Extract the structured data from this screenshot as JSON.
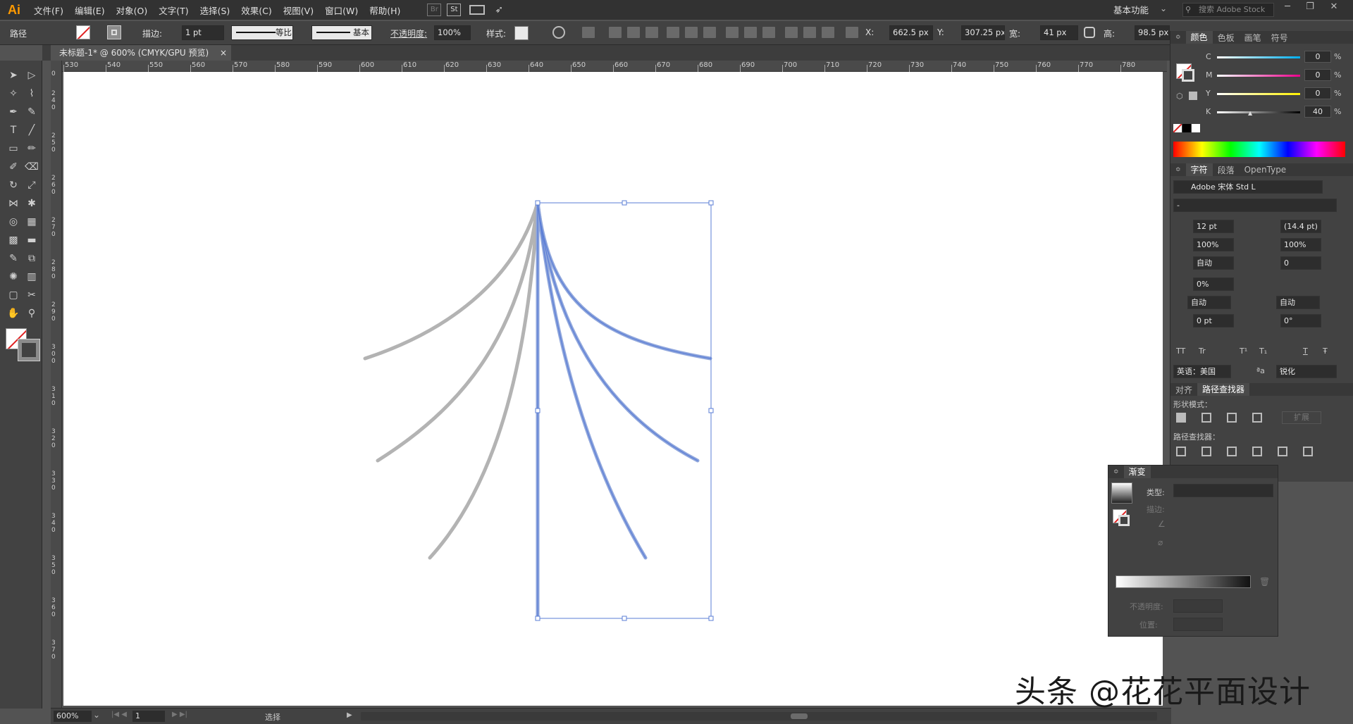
{
  "app": {
    "logo": "Ai"
  },
  "menu": [
    "文件(F)",
    "编辑(E)",
    "对象(O)",
    "文字(T)",
    "选择(S)",
    "效果(C)",
    "视图(V)",
    "窗口(W)",
    "帮助(H)"
  ],
  "menubar_right": {
    "workspace": "基本功能",
    "search_placeholder": "搜索 Adobe Stock",
    "bridge": "Br",
    "stock": "St"
  },
  "control": {
    "object_type": "路径",
    "stroke_label": "描边:",
    "stroke_weight": "1 pt",
    "profile": "等比",
    "brush": "基本",
    "opacity_label": "不透明度:",
    "opacity_value": "100%",
    "style_label": "样式:",
    "x_label": "X:",
    "x_value": "662.5 px",
    "y_label": "Y:",
    "y_value": "307.25 px",
    "w_label": "宽:",
    "w_value": "41 px",
    "h_label": "高:",
    "h_value": "98.5 px"
  },
  "document": {
    "tab_title": "未标题-1* @ 600% (CMYK/GPU 预览)",
    "close": "×"
  },
  "ruler_top": [
    "530",
    "540",
    "550",
    "560",
    "570",
    "580",
    "590",
    "600",
    "610",
    "620",
    "630",
    "640",
    "650",
    "660",
    "670",
    "680",
    "690",
    "700",
    "710",
    "720",
    "730",
    "740",
    "750",
    "760",
    "770",
    "780"
  ],
  "ruler_left": [
    "0",
    "240",
    "250",
    "260",
    "270",
    "280",
    "290",
    "300",
    "310",
    "320",
    "330",
    "340",
    "350",
    "360",
    "370"
  ],
  "status": {
    "zoom": "600%",
    "page": "1",
    "tool": "选择"
  },
  "color_panel": {
    "tabs": [
      "颜色",
      "色板",
      "画笔",
      "符号"
    ],
    "channels": [
      {
        "label": "C",
        "value": "0"
      },
      {
        "label": "M",
        "value": "0"
      },
      {
        "label": "Y",
        "value": "0"
      },
      {
        "label": "K",
        "value": "40"
      }
    ],
    "percent": "%"
  },
  "char_panel": {
    "tabs": [
      "字符",
      "段落",
      "OpenType"
    ],
    "font": "Adobe 宋体 Std L",
    "style": "-",
    "size": "12 pt",
    "leading": "(14.4 pt)",
    "vscale": "100%",
    "hscale": "100%",
    "kerning": "自动",
    "tracking": "0",
    "tsume": "0%",
    "aki_left": "自动",
    "aki_right": "自动",
    "baseline": "0 pt",
    "rotation": "0°",
    "tt": [
      "TT",
      "Tr",
      "T¹",
      "T₁",
      "T",
      "Ŧ"
    ],
    "language": "英语：美国",
    "aa_label": "ªa",
    "antialias": "锐化"
  },
  "pathfinder": {
    "tabs": [
      "对齐",
      "路径查找器"
    ],
    "shape_modes": "形状模式：",
    "expand": "扩展",
    "pathfinders": "路径查找器："
  },
  "gradient": {
    "title": "渐变",
    "type_label": "类型:",
    "stroke_label": "描边:",
    "opacity_label": "不透明度:",
    "position_label": "位置:"
  },
  "watermark": "头条 @花花平面设计",
  "colors": {
    "gray_stroke": "#b3b3b3",
    "selection": "#5a7dd6",
    "accent_logo": "#ff9a00"
  }
}
